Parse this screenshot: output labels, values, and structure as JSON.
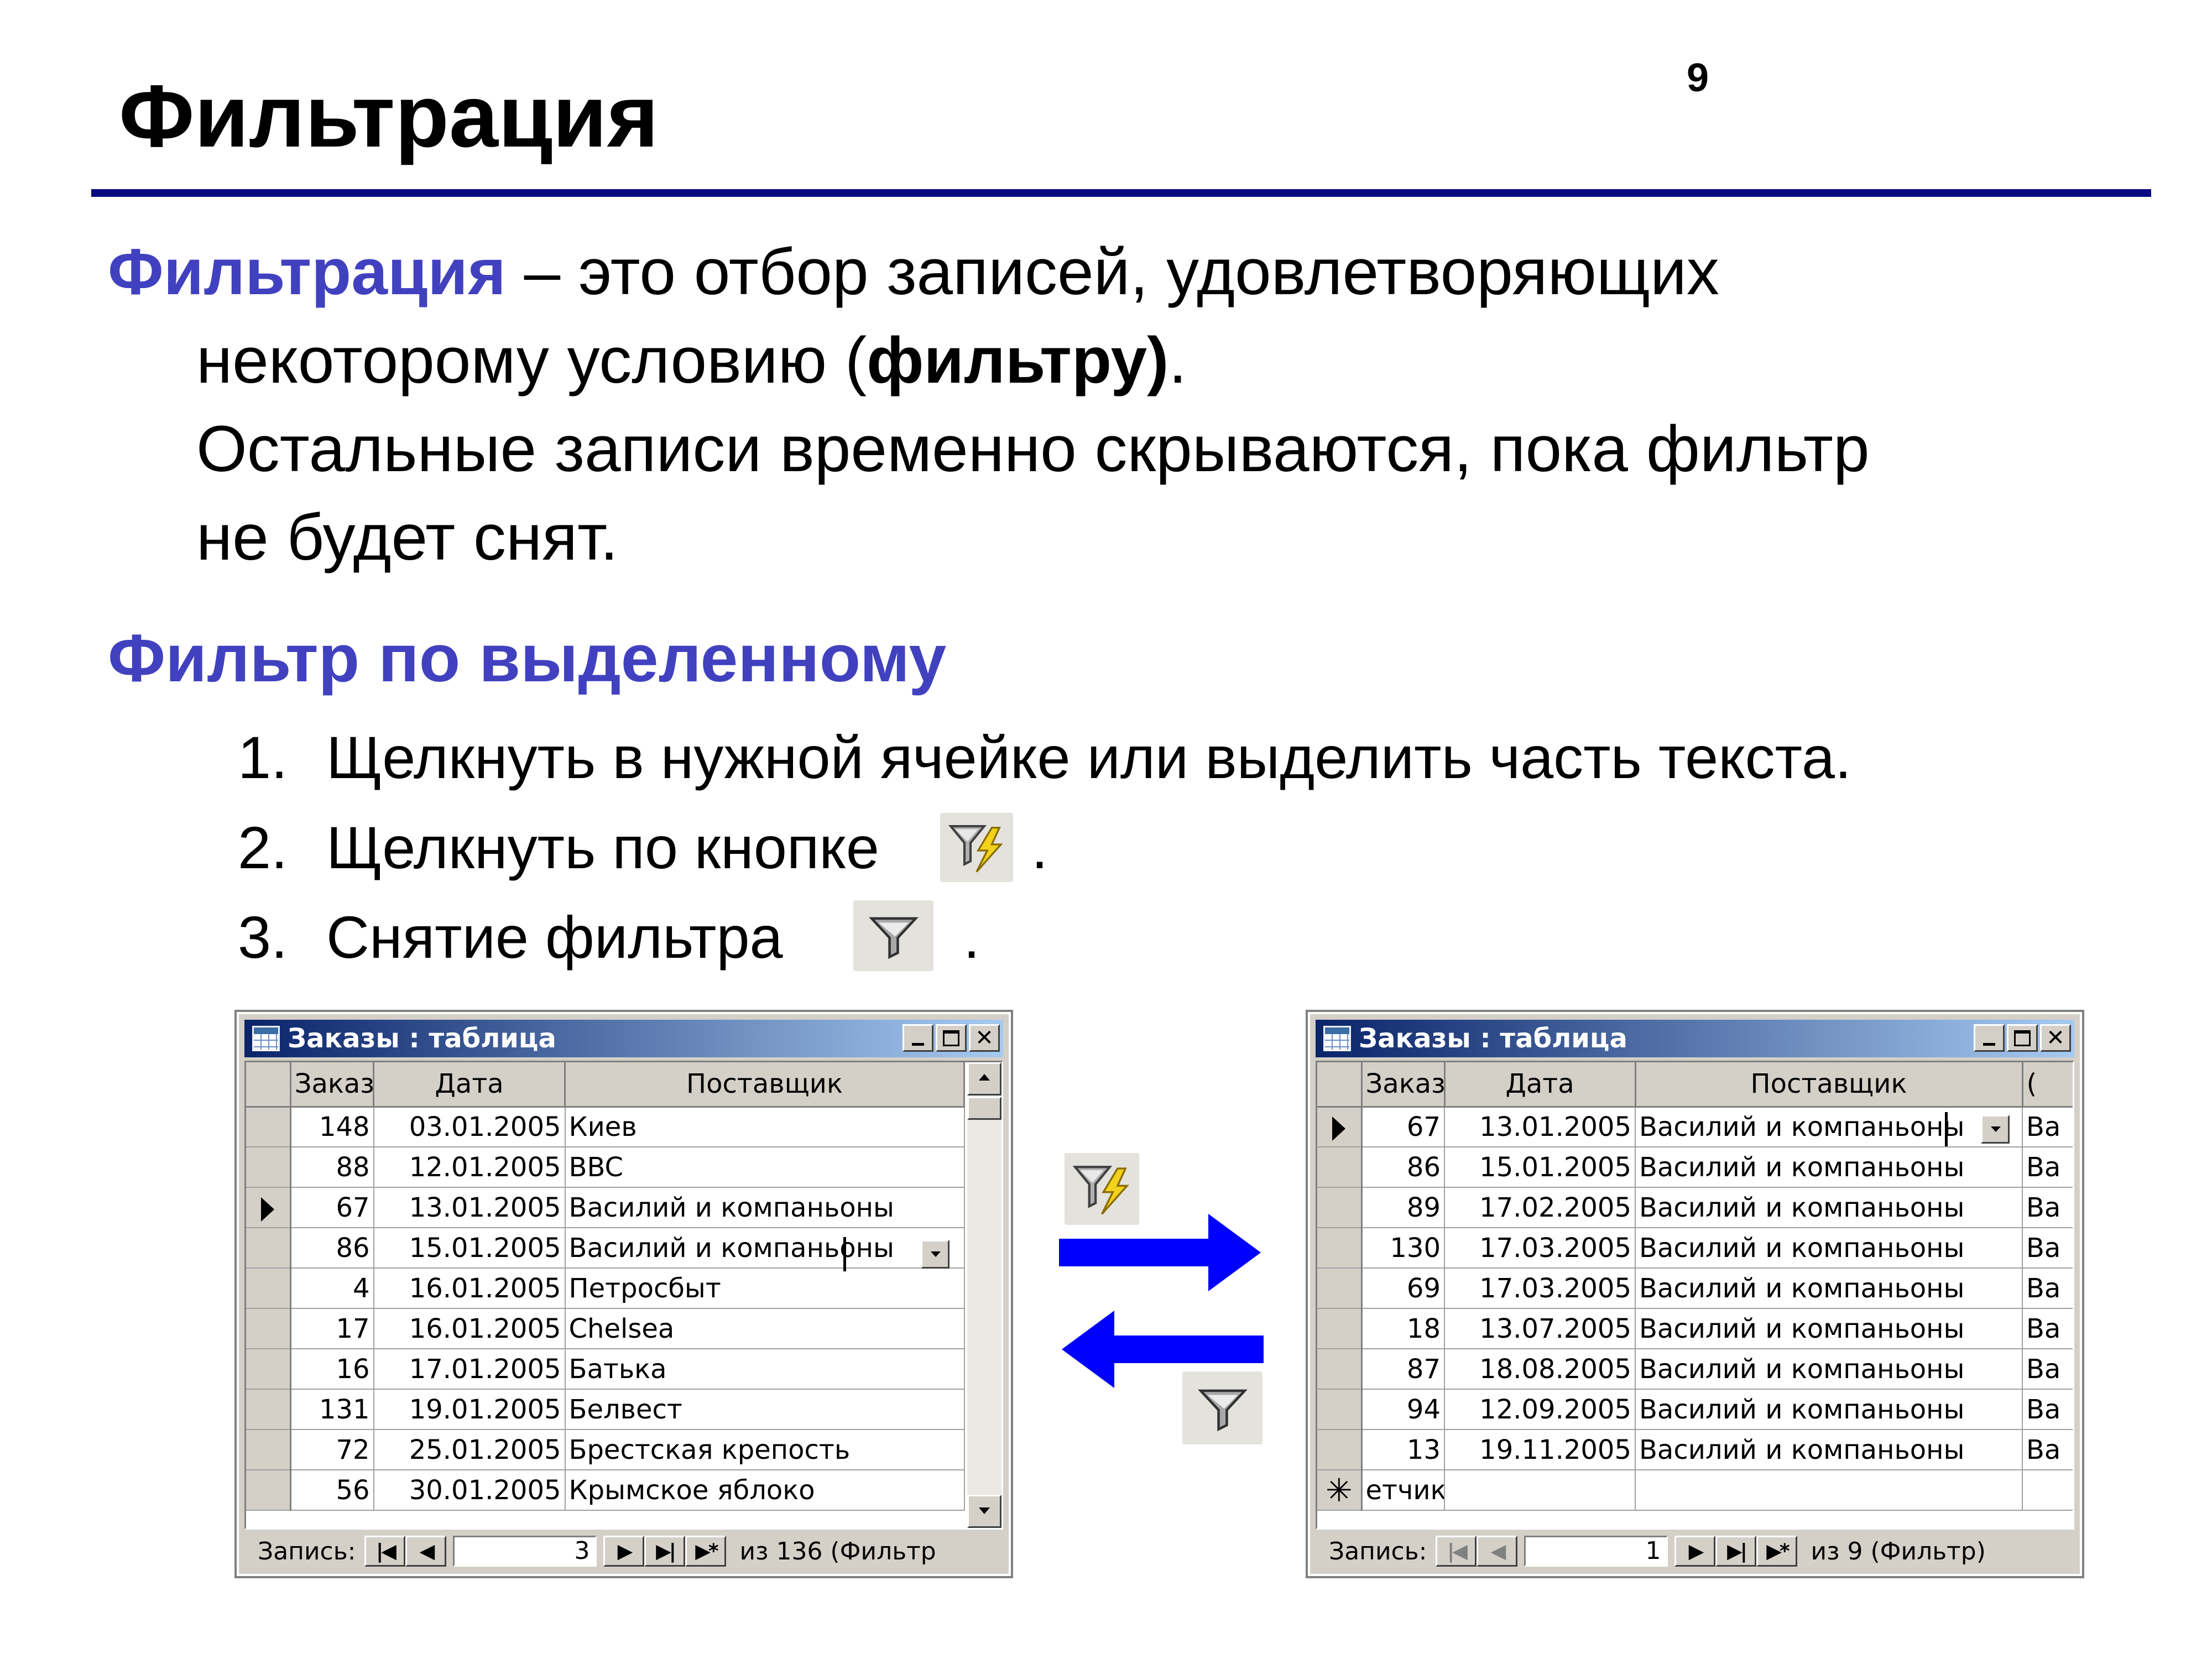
{
  "slide": {
    "page_number": "9",
    "title": "Фильтрация",
    "definition": {
      "term": "Фильтрация",
      "line1_rest": " – это отбор записей, удовлетворяющих",
      "line2_start": "некоторому условию (",
      "line2_bold": "фильтру)",
      "line2_end": ".",
      "line3": "Остальные записи временно скрываются, пока фильтр",
      "line4": "не будет снят."
    },
    "subheading": "Фильтр по выделенному",
    "steps": [
      {
        "num": "1.",
        "text": "Щелкнуть в нужной ячейке или выделить часть текста."
      },
      {
        "num": "2.",
        "text": "Щелкнуть по кнопке",
        "suffix": "."
      },
      {
        "num": "3.",
        "text": "Снятие фильтра",
        "suffix": "."
      }
    ]
  },
  "icons": {
    "filter_by_selection": "filter-lightning-icon",
    "remove_filter": "funnel-icon",
    "accent_color": "#4141c0",
    "arrow_color": "#0000ff"
  },
  "left_window": {
    "title": "Заказы : таблица",
    "columns": [
      "Заказ",
      "Дата",
      "Поставщик"
    ],
    "rows": [
      {
        "order": "148",
        "date": "03.01.2005",
        "supplier": "Киев"
      },
      {
        "order": "88",
        "date": "12.01.2005",
        "supplier": "BBC"
      },
      {
        "order": "67",
        "date": "13.01.2005",
        "supplier": "Василий и компаньоны"
      },
      {
        "order": "86",
        "date": "15.01.2005",
        "supplier": "Василий и компаньоны"
      },
      {
        "order": "4",
        "date": "16.01.2005",
        "supplier": "Петросбыт"
      },
      {
        "order": "17",
        "date": "16.01.2005",
        "supplier": "Chelsea"
      },
      {
        "order": "16",
        "date": "17.01.2005",
        "supplier": "Батька"
      },
      {
        "order": "131",
        "date": "19.01.2005",
        "supplier": "Белвест"
      },
      {
        "order": "72",
        "date": "25.01.2005",
        "supplier": "Брестская крепость"
      },
      {
        "order": "56",
        "date": "30.01.2005",
        "supplier": "Крымское яблоко"
      }
    ],
    "current_row_index": 2,
    "nav": {
      "label": "Запись:",
      "record": "3",
      "total": "из  136 (Фильтр"
    }
  },
  "right_window": {
    "title": "Заказы : таблица",
    "columns": [
      "Заказ",
      "Дата",
      "Поставщик",
      "("
    ],
    "rows": [
      {
        "order": "67",
        "date": "13.01.2005",
        "supplier": "Василий и компаньоны",
        "extra": "Ва"
      },
      {
        "order": "86",
        "date": "15.01.2005",
        "supplier": "Василий и компаньоны",
        "extra": "Ва"
      },
      {
        "order": "89",
        "date": "17.02.2005",
        "supplier": "Василий и компаньоны",
        "extra": "Ва"
      },
      {
        "order": "130",
        "date": "17.03.2005",
        "supplier": "Василий и компаньоны",
        "extra": "Ва"
      },
      {
        "order": "69",
        "date": "17.03.2005",
        "supplier": "Василий и компаньоны",
        "extra": "Ва"
      },
      {
        "order": "18",
        "date": "13.07.2005",
        "supplier": "Василий и компаньоны",
        "extra": "Ва"
      },
      {
        "order": "87",
        "date": "18.08.2005",
        "supplier": "Василий и компаньоны",
        "extra": "Ва"
      },
      {
        "order": "94",
        "date": "12.09.2005",
        "supplier": "Василий и компаньоны",
        "extra": "Ва"
      },
      {
        "order": "13",
        "date": "19.11.2005",
        "supplier": "Василий и компаньоны",
        "extra": "Ва"
      }
    ],
    "new_row_text": "етчик)",
    "current_row_index": 0,
    "nav": {
      "label": "Запись:",
      "record": "1",
      "total": "из  9 (Фильтр)"
    }
  }
}
